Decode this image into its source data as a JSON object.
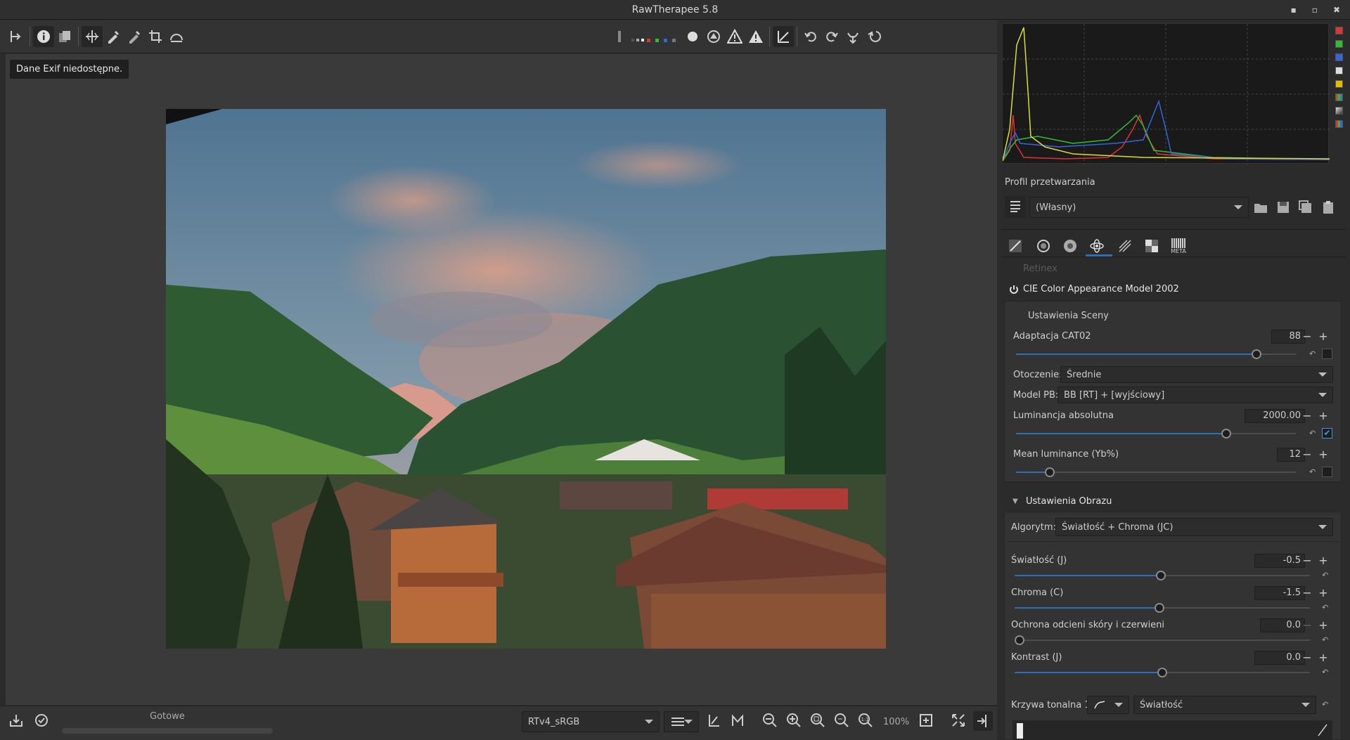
{
  "window": {
    "title": "RawTherapee 5.8",
    "minimize": "▪",
    "restore": "▫",
    "close": "✖"
  },
  "toolbar": {
    "icons": [
      "expand-left-icon",
      "info-icon",
      "before-after-icon",
      "hand-select-icon",
      "color-picker-icon",
      "white-balance-picker-icon",
      "crop-icon",
      "straighten-icon",
      "focus-mask-icon",
      "r-channel-icon",
      "g-channel-icon",
      "b-channel-icon",
      "luminance-icon",
      "clipping-highlight-icon",
      "clipping-shadow-icon",
      "warning-icon",
      "rotate-left-icon",
      "rotate-right-icon",
      "flip-horizontal-icon",
      "flip-vertical-icon"
    ]
  },
  "viewer": {
    "exif_tooltip": "Dane Exif niedostępne."
  },
  "bottombar": {
    "status": "Gotowe",
    "profile": "RTv4_sRGB",
    "zoom": "100%"
  },
  "right": {
    "processing_profile_label": "Profil przetwarzania",
    "profile_value": "(Własny)",
    "tabs": [
      "exposure-tab-icon",
      "detail-tab-icon",
      "color-tab-icon",
      "advanced-tab-icon",
      "transform-tab-icon",
      "raw-tab-icon",
      "metadata-tab-icon"
    ],
    "meta_label": "META",
    "retinex_label": "Retinex",
    "ciecam_title": "CIE Color Appearance Model 2002",
    "scene": {
      "header": "Ustawienia Sceny",
      "cat02_label": "Adaptacja CAT02",
      "cat02_value": "88",
      "cat02_frac": 0.86,
      "surround_label": "Otoczenie:",
      "surround_value": "Średnie",
      "wb_label": "Model PB:",
      "wb_value": "BB [RT] + [wyjściowy]",
      "abs_lum_label": "Luminancja absolutna",
      "abs_lum_value": "2000.00",
      "abs_lum_frac": 0.75,
      "mean_lum_label": "Mean luminance (Yb%)",
      "mean_lum_value": "12",
      "mean_lum_frac": 0.12
    },
    "image": {
      "header": "Ustawienia Obrazu",
      "algo_label": "Algorytm:",
      "algo_value": "Światłość + Chroma (JC)",
      "lightness_label": "Światłość (J)",
      "lightness_value": "-0.5",
      "lightness_frac": 0.495,
      "chroma_label": "Chroma (C)",
      "chroma_value": "-1.5",
      "chroma_frac": 0.49,
      "skin_label": "Ochrona odcieni skóry i czerwieni",
      "skin_value": "0.0",
      "skin_frac": 0.0,
      "contrast_label": "Kontrast (J)",
      "contrast_value": "0.0",
      "contrast_frac": 0.5,
      "curve_label": "Krzywa tonalna 1:",
      "curve_value": "Światłość"
    },
    "minus": "−",
    "plus": "+"
  },
  "colors": {
    "accent": "#2f6fb4",
    "panel": "#333333",
    "bg": "#2b2b2b"
  }
}
